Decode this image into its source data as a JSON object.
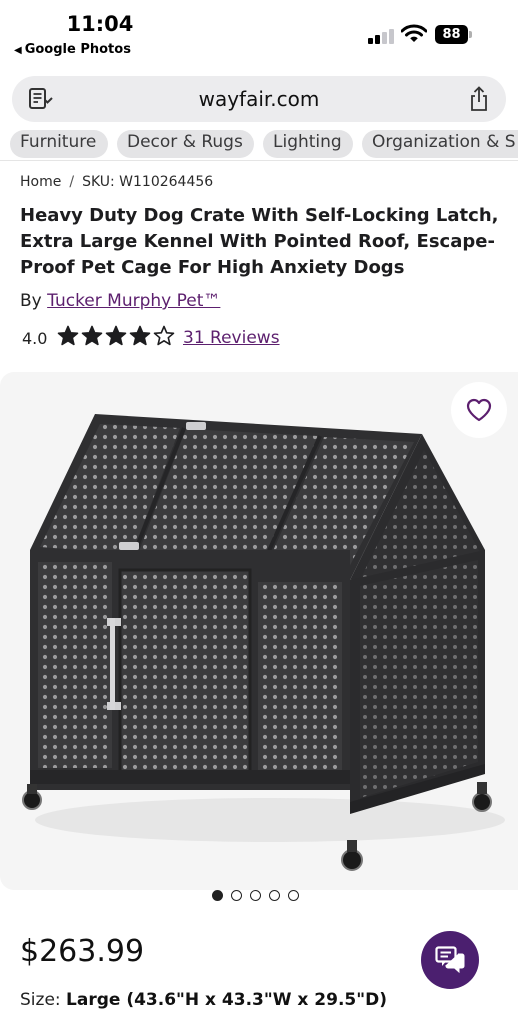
{
  "status_bar": {
    "time": "11:04",
    "back_app": "Google Photos",
    "battery": "88"
  },
  "browser": {
    "url": "wayfair.com",
    "icons": [
      "reader-icon",
      "share-icon"
    ]
  },
  "categories": [
    {
      "label": "Furniture"
    },
    {
      "label": "Decor & Rugs"
    },
    {
      "label": "Lighting"
    },
    {
      "label": "Organization & S"
    }
  ],
  "breadcrumb": {
    "home": "Home",
    "separator": "/",
    "sku": "SKU: W110264456"
  },
  "product": {
    "title": "Heavy Duty Dog Crate With Self-Locking Latch, Extra Large Kennel With Pointed Roof, Escape-Proof Pet Cage For High Anxiety Dogs",
    "by_prefix": "By",
    "brand": "Tucker Murphy Pet™",
    "rating": "4.0",
    "rating_value": 4,
    "rating_max": 5,
    "reviews": "31 Reviews",
    "image_count": 5,
    "active_image": 0,
    "price": "$263.99",
    "size_label": "Size:",
    "size_value": "Large (43.6\"H x 43.3\"W x 29.5\"D)"
  },
  "colors": {
    "brand_purple": "#5c1f6e",
    "chat_button": "#4b1f6f",
    "chip_bg": "#e4e4e6",
    "image_bg": "#f5f5f5"
  }
}
